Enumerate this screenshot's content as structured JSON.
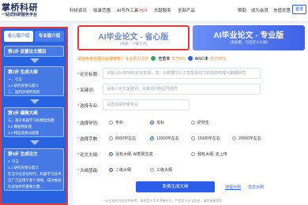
{
  "header": {
    "logo_main": "掌桥科研",
    "logo_sub": "一站式科研服务平台",
    "nav": [
      "科技资讯",
      "收录范围",
      "AI写作工具",
      "文献服务",
      "全部产品"
    ],
    "nav_hot": "HOT",
    "right": [
      "帮助",
      "成为会员",
      "充值优惠"
    ],
    "login": "登录"
  },
  "sidebar": {
    "tabs": [
      "省心版介绍",
      "专业版介绍"
    ],
    "sections": [
      {
        "head": "第1步 设置论文题目",
        "items": []
      },
      {
        "head": "第2步 生成大纲",
        "items": [
          "一、引言",
          "1.1 研究背景与意义",
          "二、国内外研究现状"
        ]
      },
      {
        "head": "第3步 编辑大纲",
        "items": [
          "三、基于机器学习的模型构建",
          "3.1 数据预处理",
          "3.2 特征选择与提取"
        ]
      },
      {
        "head": "第4步 生成论文",
        "items": [
          "1. 引言",
          "1.1 研究背景与意义",
          "在当今信息化时代，机器学习技术",
          "已广泛应用于各个领域，成为推动",
          "社会进步的重要力量..."
        ]
      }
    ]
  },
  "switcher": {
    "left_title": "AI毕业论文 - 省心版",
    "left_sub": "(简捷、一键写完)",
    "right_title": "AI毕业论文 - 专业版",
    "right_sub": "(高质量、可自定义大纲)"
  },
  "notice": {
    "warning": "请在参考范围内合理使用",
    "sep": "|",
    "tag1": "专业助力写作",
    "text1": "查重率",
    "val1": "低于8%",
    "text2": "AIGC率",
    "val2": "低于30%"
  },
  "form": {
    "title_label": "论文标题:",
    "title_placeholder": "请输入5~50字的论文标题，如：大数据与人工智能驱动下的创新管理与策略研究",
    "keywords_label": "关键词:",
    "keywords_placeholder": "请输入论文关键词，关键词间用逗号隔开",
    "major_label": "选择专业:",
    "major_placeholder": "请选择或搜索专业",
    "degree_label": "选择学历:",
    "degree_options": [
      "专科",
      "本科",
      "研究生"
    ],
    "degree_selected": 1,
    "wordcount_label": "选择字数:",
    "wordcount_options": [
      "8000字左右",
      "12000字左右",
      "15000字左右",
      "20000字左右"
    ],
    "wordcount_selected": 1,
    "outline_label": "论文大纲:",
    "outline_options": [
      "没有大纲, AI帮我生成",
      "我有大纲, 去上传"
    ],
    "outline_selected": 0,
    "level_label": "大纲层级:",
    "level_options": [
      "二级大纲",
      "三级大纲"
    ],
    "level_selected": 0
  },
  "actions": {
    "submit": "免费生成大纲",
    "flow_link": "流程示例",
    "sample_link": "范文示例",
    "disclaimer": "*AI生成的内容仅供参考，请勿用于学术不端行为，严禁用于非法用途，请勿直接提交"
  },
  "colors": {
    "accent": "#2a5ee8",
    "sidebar": "#2763e0",
    "highlight": "#e53935",
    "warning": "#ff7a00"
  }
}
